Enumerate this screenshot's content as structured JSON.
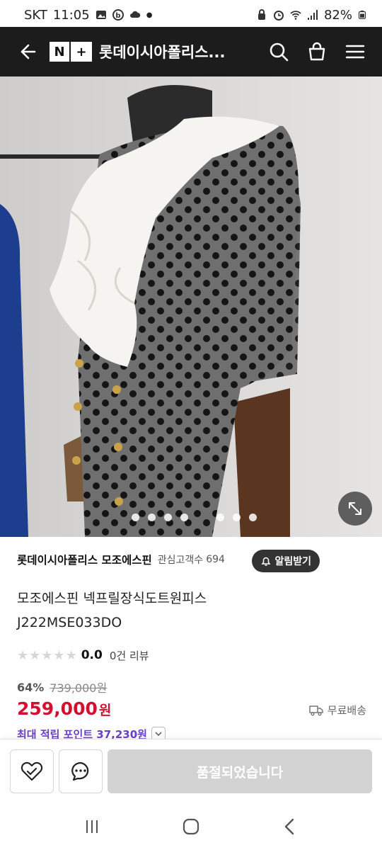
{
  "status_bar": {
    "carrier": "SKT",
    "time": "11:05",
    "battery": "82%"
  },
  "header": {
    "logo_n": "N",
    "logo_plus": "+",
    "store_title": "롯데이시아폴리스..."
  },
  "gallery": {
    "dot_count": 7,
    "active_index": 0
  },
  "store": {
    "name": "롯데이시아폴리스 모조에스핀",
    "follower_label": "관심고객수",
    "follower_count": "694",
    "alert_label": "알림받기"
  },
  "product": {
    "name_line1": "모조에스핀 넥프릴장식도트원피스",
    "name_line2": "J222MSE033DO",
    "rating": "0.0",
    "review_count": "0건 리뷰",
    "discount": "64%",
    "original_price": "739,000원",
    "price": "259,000",
    "price_unit": "원",
    "shipping": "무료배송",
    "points": "최대 적립 포인트 37,230원"
  },
  "actions": {
    "soldout_label": "품절되었습니다"
  },
  "colors": {
    "price": "#d40f2f",
    "points": "#6a3fc7",
    "header_bg": "#1c1c1c"
  }
}
